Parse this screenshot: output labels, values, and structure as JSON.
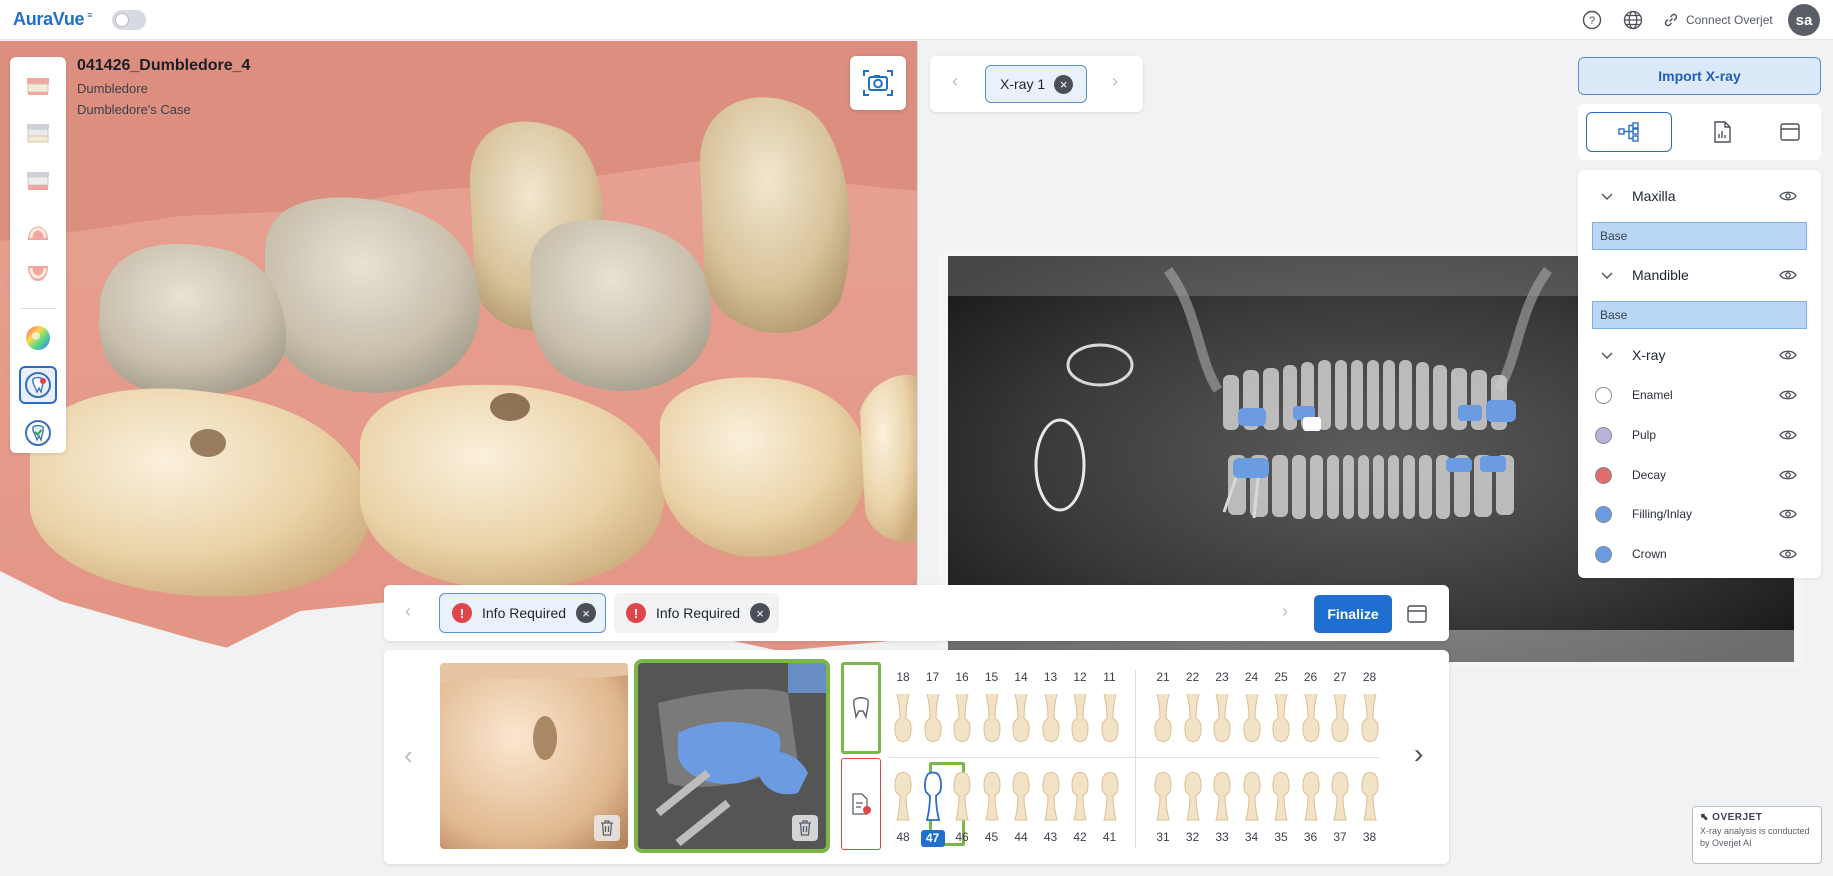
{
  "app": {
    "brand": "AuraVue",
    "brand_mark": "≡",
    "avatar_initials": "sa",
    "connect_label": "Connect Overjet"
  },
  "case": {
    "title": "041426_Dumbledore_4",
    "patient": "Dumbledore",
    "case_name": "Dumbledore's Case"
  },
  "scan_toolbar": {
    "items": [
      "upper-jaw",
      "both-jaws",
      "lower-jaw",
      "maxilla-occlusal",
      "mandible-occlusal",
      "color-map",
      "tooth-scan",
      "tooth-check"
    ]
  },
  "xray": {
    "tab_label": "X-ray 1"
  },
  "right_panel": {
    "import_label": "Import X-ray",
    "groups": [
      {
        "label": "Maxilla",
        "base": "Base"
      },
      {
        "label": "Mandible",
        "base": "Base"
      },
      {
        "label": "X-ray"
      }
    ],
    "layers": [
      {
        "label": "Enamel",
        "color": "#ffffff"
      },
      {
        "label": "Pulp",
        "color": "#b8b3db"
      },
      {
        "label": "Decay",
        "color": "#e06c6c"
      },
      {
        "label": "Filling/Inlay",
        "color": "#6b9be0"
      },
      {
        "label": "Crown",
        "color": "#6b9be0"
      }
    ]
  },
  "findings": {
    "tabs": [
      {
        "label": "Info Required"
      },
      {
        "label": "Info Required"
      }
    ],
    "finalize_label": "Finalize",
    "warn_mark": "!",
    "close_mark": "×"
  },
  "tooth_chart": {
    "upper_right": [
      "18",
      "17",
      "16",
      "15",
      "14",
      "13",
      "12",
      "11"
    ],
    "upper_left": [
      "21",
      "22",
      "23",
      "24",
      "25",
      "26",
      "27",
      "28"
    ],
    "lower_right": [
      "48",
      "47",
      "46",
      "45",
      "44",
      "43",
      "42",
      "41"
    ],
    "lower_left": [
      "31",
      "32",
      "33",
      "34",
      "35",
      "36",
      "37",
      "38"
    ],
    "selected": "47"
  },
  "overjet": {
    "logo": "OVERJET",
    "note": "X-ray analysis is conducted by Overjet AI"
  },
  "colors": {
    "accent": "#1f6fd1",
    "selected_outline": "#7ab648",
    "warn": "#e0454b"
  }
}
